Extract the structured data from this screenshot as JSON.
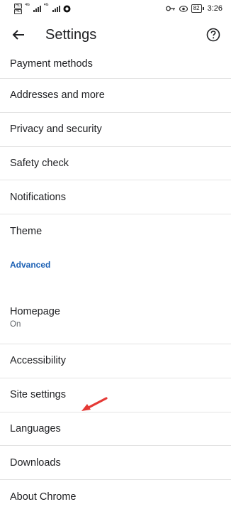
{
  "status_bar": {
    "sim1_label": "HD",
    "sim2_label": "HD",
    "net1": "4G",
    "net2": "4G",
    "battery_level": "82",
    "time": "3:26"
  },
  "toolbar": {
    "title": "Settings",
    "back_icon": "arrow-back-icon",
    "help_icon": "help-circle-icon"
  },
  "settings": {
    "items": [
      {
        "label": "Payment methods"
      },
      {
        "label": "Addresses and more"
      },
      {
        "label": "Privacy and security"
      },
      {
        "label": "Safety check"
      },
      {
        "label": "Notifications"
      },
      {
        "label": "Theme"
      }
    ],
    "advanced_header": "Advanced",
    "homepage": {
      "label": "Homepage",
      "sub": "On"
    },
    "advanced_items": [
      {
        "label": "Accessibility"
      },
      {
        "label": "Site settings"
      },
      {
        "label": "Languages"
      },
      {
        "label": "Downloads"
      },
      {
        "label": "About Chrome"
      }
    ]
  },
  "annotation": {
    "arrow_color": "#e53935"
  }
}
